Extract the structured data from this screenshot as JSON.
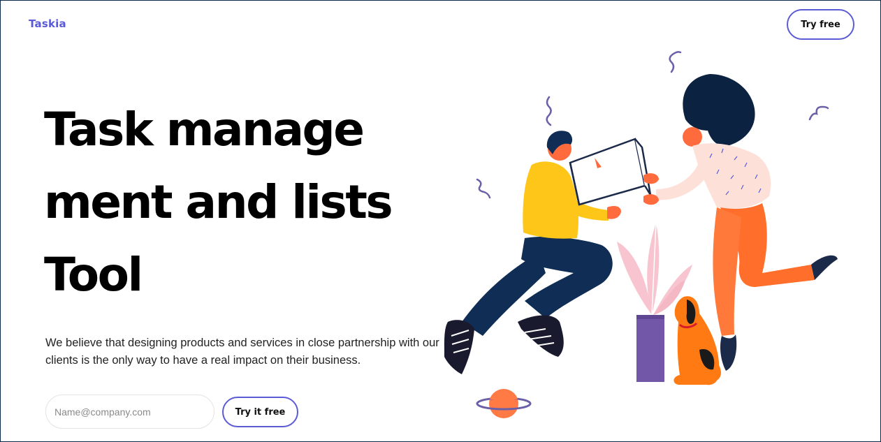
{
  "brand": {
    "name": "Taskia",
    "color": "#5a5ad8"
  },
  "nav": {
    "cta_label": "Try free"
  },
  "hero": {
    "title_lines": [
      "Task manage",
      "ment and lists",
      "Tool"
    ],
    "description": "We believe that designing products and services in close partnership with our clients is the only way to have a real impact on their business.",
    "email_placeholder": "Name@company.com",
    "cta_label": "Try it free"
  },
  "colors": {
    "accent": "#5b5bd6",
    "text": "#000000",
    "background": "#ffffff"
  }
}
